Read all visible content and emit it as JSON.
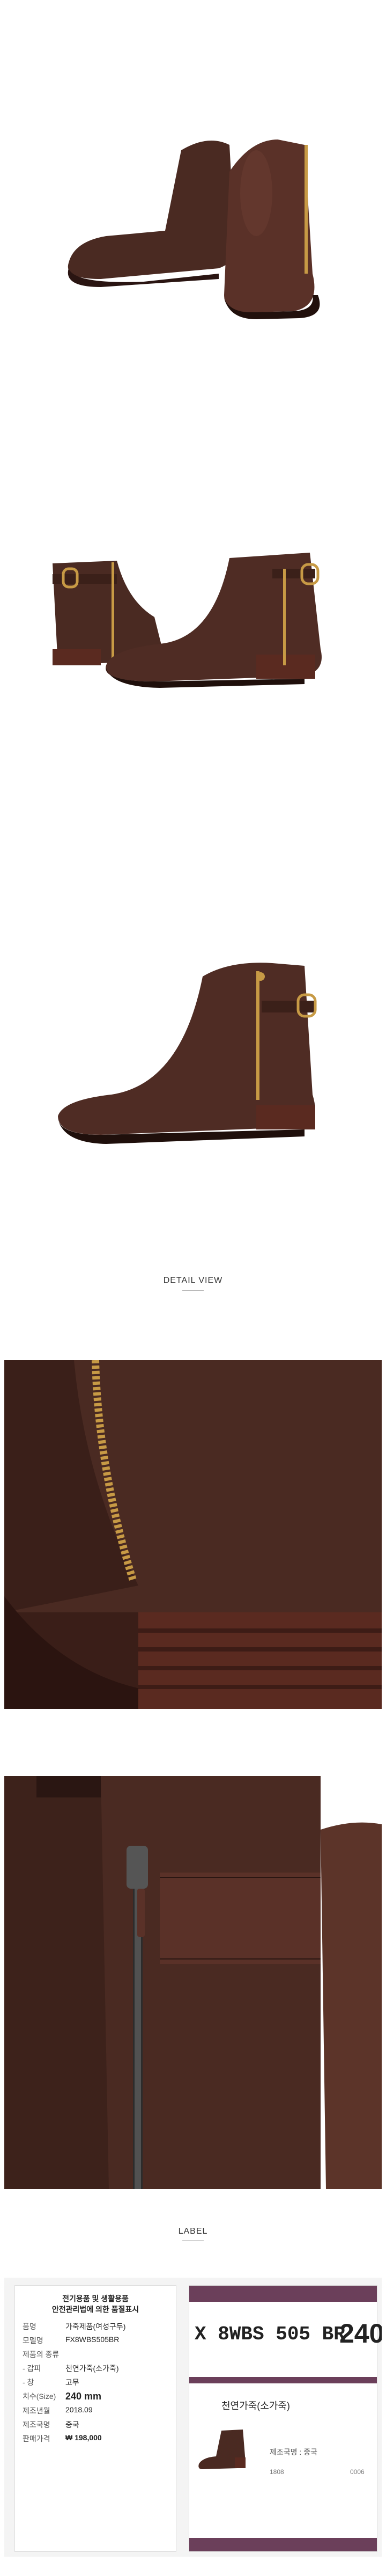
{
  "sections": {
    "detail_heading": "DETAIL VIEW",
    "label_heading": "LABEL"
  },
  "label_card": {
    "title_line1": "전기용품 및 생활용품",
    "title_line2": "안전관리법에 의한 품질표시",
    "rows": [
      {
        "key": "품명",
        "value": "가죽제품(여성구두)"
      },
      {
        "key": "모델명",
        "value": "FX8WBS505BR"
      },
      {
        "key": "제품의 종류",
        "value": ""
      },
      {
        "key": "- 갑피",
        "value": "천연가죽(소가죽)"
      },
      {
        "key": "- 창",
        "value": "고무"
      },
      {
        "key": "치수(Size)",
        "value": "240 mm"
      },
      {
        "key": "제조년월",
        "value": "2018.09"
      },
      {
        "key": "제조국명",
        "value": "중국"
      },
      {
        "key": "판매가격",
        "value": "₩ 198,000"
      }
    ]
  },
  "label_tag": {
    "model_code": "X 8WBS 505 BR",
    "size": "240",
    "material": "천연가죽(소가죽)",
    "origin": "제조국명 : 중국",
    "small_left": "1808",
    "small_right": "0006"
  },
  "colors": {
    "leather": "#4a2a22",
    "sole": "#5a2a20",
    "zipper": "#c79a45",
    "tag_brand": "#6b3f5a"
  }
}
